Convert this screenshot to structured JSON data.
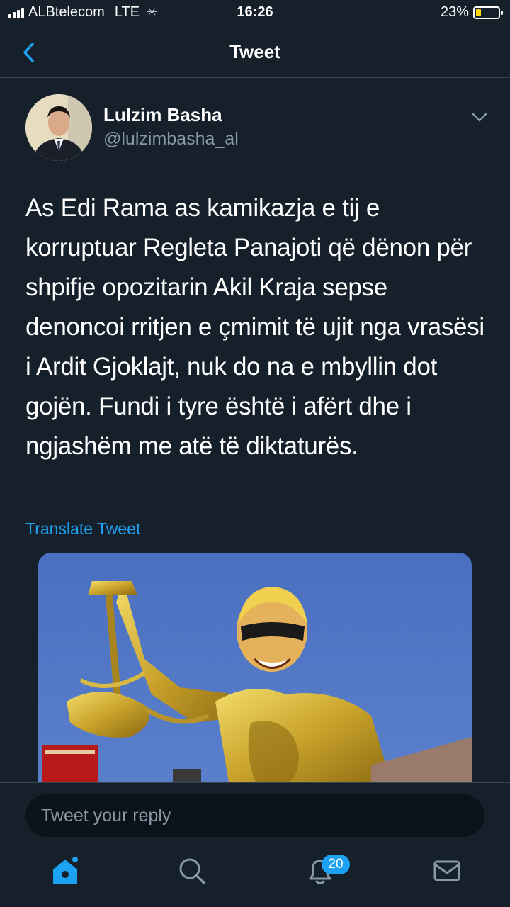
{
  "status_bar": {
    "carrier": "ALBtelecom",
    "network": "LTE",
    "time": "16:26",
    "battery_percent": "23%",
    "battery_level": 0.23
  },
  "nav": {
    "title": "Tweet",
    "back_icon": "chevron-left-icon"
  },
  "tweet": {
    "author_name": "Lulzim Basha",
    "author_handle": "@lulzimbasha_al",
    "text": "As Edi Rama as kamikazja e tij e korruptuar Regleta Panajoti që dënon për shpifje opozitarin Akil Kraja sepse denoncoi rritjen e çmimit të ujit nga vrasësi i Ardit Gjoklajt, nuk do na e mbyllin dot gojën. Fundi i tyre është i afërt dhe i ngjashëm me atë të diktaturës.",
    "translate_label": "Translate Tweet"
  },
  "reply": {
    "placeholder": "Tweet your reply"
  },
  "tab_bar": {
    "notifications_count": "20",
    "icons": [
      "home-icon",
      "search-icon",
      "notifications-icon",
      "messages-icon"
    ]
  },
  "colors": {
    "background": "#15202b",
    "accent": "#1da1f2",
    "secondary_text": "#8899a6"
  }
}
